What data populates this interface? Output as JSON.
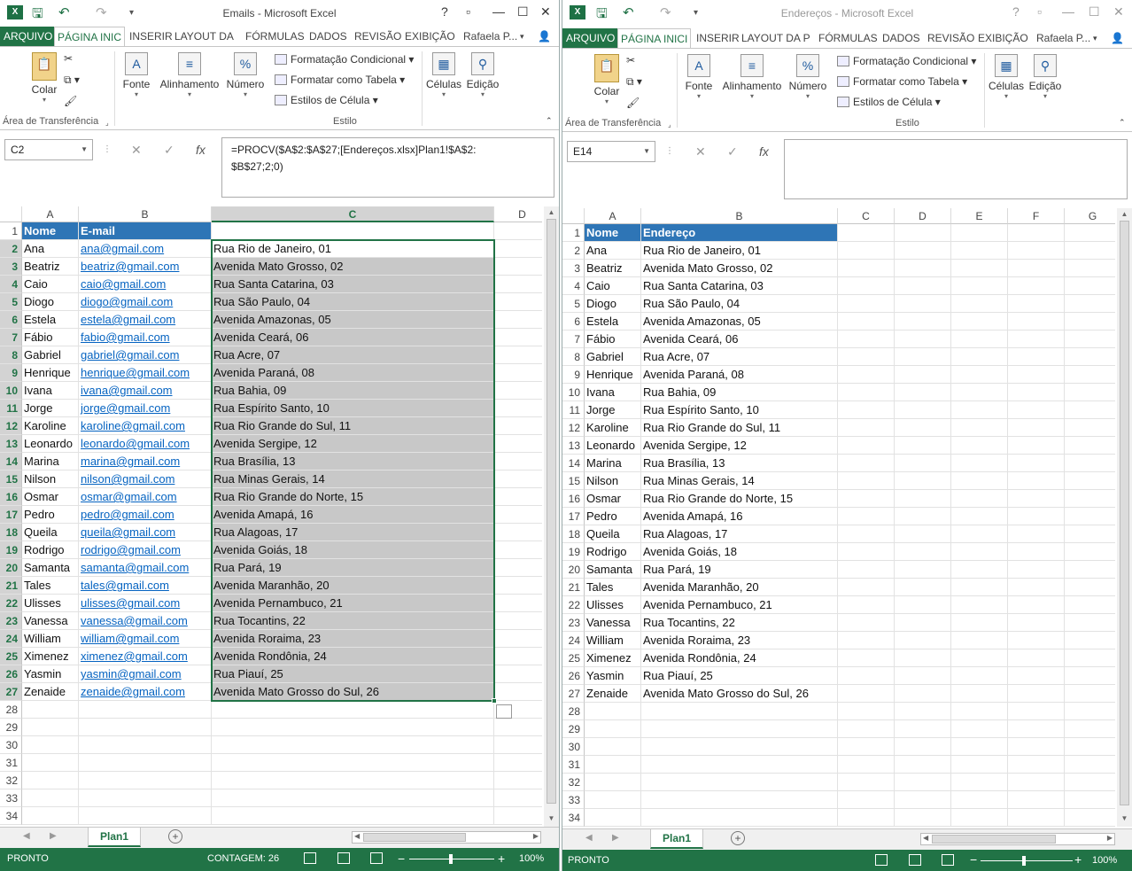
{
  "left": {
    "title": "Emails - Microsoft Excel",
    "tabs": [
      "ARQUIVO",
      "PÁGINA INIC",
      "INSERIR",
      "LAYOUT DA",
      "FÓRMULAS",
      "DADOS",
      "REVISÃO",
      "EXIBIÇÃO"
    ],
    "user": "Rafaela P...",
    "ribbon": {
      "colar": "Colar",
      "fonte": "Fonte",
      "alinhamento": "Alinhamento",
      "numero": "Número",
      "formatacao_condicional": "Formatação Condicional",
      "formatar_como_tabela": "Formatar como Tabela",
      "estilos_celula": "Estilos de Célula",
      "celulas": "Células",
      "edicao": "Edição",
      "area_transferencia": "Área de Transferência",
      "estilo": "Estilo"
    },
    "namebox": "C2",
    "formula": "=PROCV($A$2:$A$27;[Endereços.xlsx]Plan1!$A$2:\n$B$27;2;0)",
    "columns": [
      "A",
      "B",
      "C",
      "D"
    ],
    "header": [
      "Nome",
      "E-mail",
      ""
    ],
    "rows": [
      [
        "Ana",
        "ana@gmail.com",
        "Rua Rio de Janeiro, 01"
      ],
      [
        "Beatriz",
        "beatriz@gmail.com",
        "Avenida Mato Grosso, 02"
      ],
      [
        "Caio",
        "caio@gmail.com",
        "Rua Santa Catarina, 03"
      ],
      [
        "Diogo",
        "diogo@gmail.com",
        "Rua São Paulo, 04"
      ],
      [
        "Estela",
        "estela@gmail.com",
        "Avenida Amazonas, 05"
      ],
      [
        "Fábio",
        "fabio@gmail.com",
        "Avenida Ceará, 06"
      ],
      [
        "Gabriel",
        "gabriel@gmail.com",
        "Rua Acre, 07"
      ],
      [
        "Henrique",
        "henrique@gmail.com",
        "Avenida Paraná, 08"
      ],
      [
        "Ivana",
        "ivana@gmail.com",
        "Rua Bahia, 09"
      ],
      [
        "Jorge",
        "jorge@gmail.com",
        "Rua Espírito Santo, 10"
      ],
      [
        "Karoline",
        "karoline@gmail.com",
        "Rua Rio Grande do Sul, 11"
      ],
      [
        "Leonardo",
        "leonardo@gmail.com",
        "Avenida Sergipe, 12"
      ],
      [
        "Marina",
        "marina@gmail.com",
        "Rua Brasília, 13"
      ],
      [
        "Nilson",
        "nilson@gmail.com",
        "Rua Minas Gerais, 14"
      ],
      [
        "Osmar",
        "osmar@gmail.com",
        "Rua Rio Grande do Norte, 15"
      ],
      [
        "Pedro",
        "pedro@gmail.com",
        "Avenida Amapá, 16"
      ],
      [
        "Queila",
        "queila@gmail.com",
        "Rua Alagoas, 17"
      ],
      [
        "Rodrigo",
        "rodrigo@gmail.com",
        "Avenida Goiás, 18"
      ],
      [
        "Samanta",
        "samanta@gmail.com",
        "Rua Pará, 19"
      ],
      [
        "Tales",
        "tales@gmail.com",
        "Avenida Maranhão, 20"
      ],
      [
        "Ulisses",
        "ulisses@gmail.com",
        "Avenida Pernambuco, 21"
      ],
      [
        "Vanessa",
        "vanessa@gmail.com",
        "Rua Tocantins, 22"
      ],
      [
        "William",
        "william@gmail.com",
        "Avenida Roraima, 23"
      ],
      [
        "Ximenez",
        "ximenez@gmail.com",
        "Avenida Rondônia, 24"
      ],
      [
        "Yasmin",
        "yasmin@gmail.com",
        "Rua Piauí, 25"
      ],
      [
        "Zenaide",
        "zenaide@gmail.com",
        "Avenida Mato Grosso do Sul, 26"
      ]
    ],
    "row_numbers": [
      1,
      2,
      3,
      4,
      5,
      6,
      7,
      8,
      9,
      10,
      11,
      12,
      13,
      14,
      15,
      16,
      17,
      18,
      19,
      20,
      21,
      22,
      23,
      24,
      25,
      26,
      27,
      28,
      29,
      30,
      31,
      32,
      33,
      34
    ],
    "sheet": "Plan1",
    "status": "PRONTO",
    "count": "CONTAGEM: 26",
    "zoom": "100%"
  },
  "right": {
    "title": "Endereços - Microsoft Excel",
    "tabs": [
      "ARQUIVO",
      "PÁGINA INICI",
      "INSERIR",
      "LAYOUT DA P",
      "FÓRMULAS",
      "DADOS",
      "REVISÃO",
      "EXIBIÇÃO"
    ],
    "user": "Rafaela P...",
    "namebox": "E14",
    "formula": "",
    "columns": [
      "A",
      "B",
      "C",
      "D",
      "E",
      "F",
      "G"
    ],
    "header": [
      "Nome",
      "Endereço"
    ],
    "sheet": "Plan1",
    "status": "PRONTO",
    "zoom": "100%"
  },
  "colors": {
    "excel_green": "#217346",
    "header_blue": "#2e75b6",
    "link": "#0563c1",
    "selection_gray": "#c8c8c8"
  }
}
